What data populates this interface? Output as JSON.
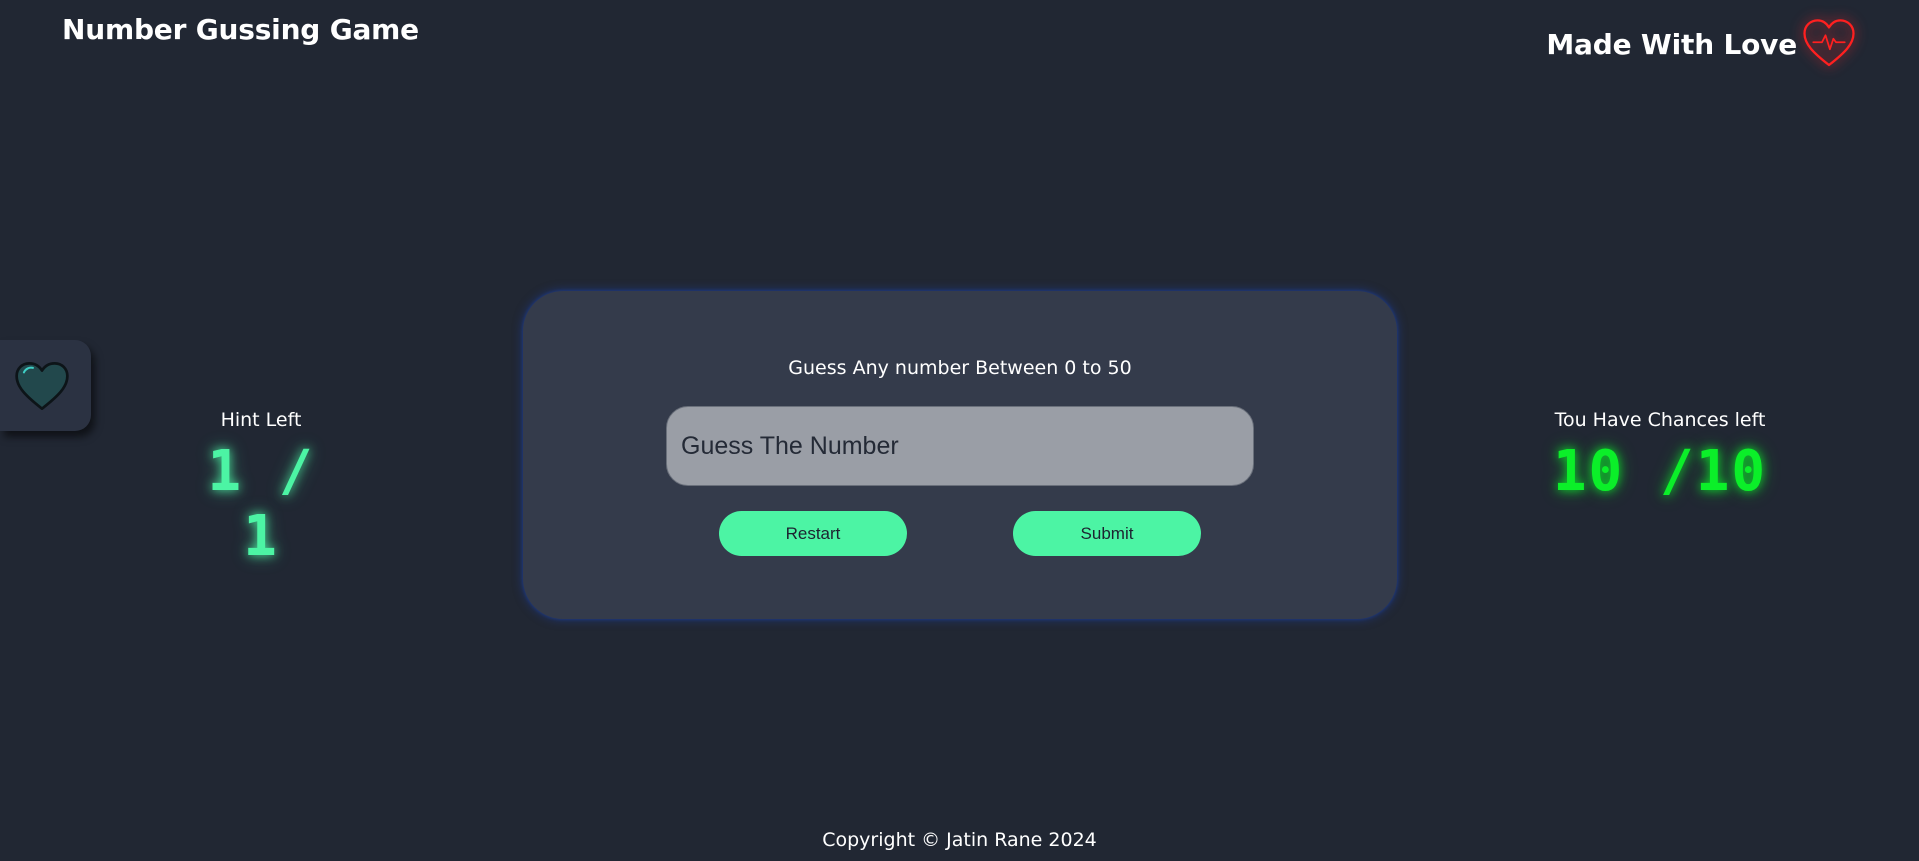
{
  "header": {
    "app_title": "Number Gussing Game",
    "made_with_love": "Made With Love"
  },
  "hints": {
    "label": "Hint Left",
    "value": "1 / 1"
  },
  "chances": {
    "label": "Tou Have Chances left",
    "value": "10 /10"
  },
  "card": {
    "prompt": "Guess Any number Between 0 to 50",
    "input_placeholder": "Guess The Number",
    "restart_label": "Restart",
    "submit_label": "Submit"
  },
  "footer": {
    "copyright": "Copyright © Jatin Rane 2024"
  },
  "icons": {
    "love_heart": "heart-pulse-icon",
    "side_heart": "heart-icon"
  },
  "colors": {
    "background": "#212733",
    "card": "#343b4b",
    "accent": "#4cf4a4",
    "chances": "#0bef29",
    "heart_red": "#ff2020"
  }
}
